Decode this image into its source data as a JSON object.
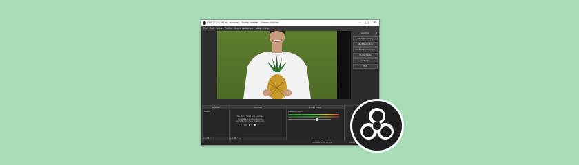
{
  "window": {
    "title": "OBS 27.2.4 (64-bit, windows) - Profile: Untitled - Scenes: Untitled",
    "controls": {
      "minimize": "–",
      "maximize": "□",
      "close": "✕"
    }
  },
  "menu": [
    "File",
    "Edit",
    "View",
    "Profile",
    "Scene Collection",
    "Tools",
    "Help"
  ],
  "preview": {
    "status": "No source selected",
    "tabs": [
      "Properties",
      "Filters"
    ]
  },
  "controls": {
    "title": "Controls",
    "close": "✕",
    "buttons": [
      "Start Streaming",
      "Start Recording",
      "Start Virtual Camera",
      "Studio Mode",
      "Settings",
      "Exit"
    ]
  },
  "docks": {
    "scenes": {
      "title": "Scenes",
      "items": [
        "Scene"
      ]
    },
    "sources": {
      "title": "Sources",
      "hint": [
        "You don't have any sources.",
        "Click the + button below,",
        "or right click here to add one."
      ],
      "icons": "⬚ ▭ ◐ ▣"
    },
    "mixer": {
      "title": "Audio Mixer",
      "channel": "Desktop Audio"
    }
  },
  "footer_controls": "+ − ⚙ ⌃ ⌄",
  "statusbar": {
    "fps": "CPU: 0.6%, 30.00 fps",
    "time": "00:00:00"
  },
  "colors": {
    "background": "#a8dcb6",
    "obs_dark": "#2f2f2f",
    "logo_bg": "#1f1f1f"
  },
  "icons": {
    "app": "obs-logo-icon",
    "logo": "obs-logo-icon"
  }
}
